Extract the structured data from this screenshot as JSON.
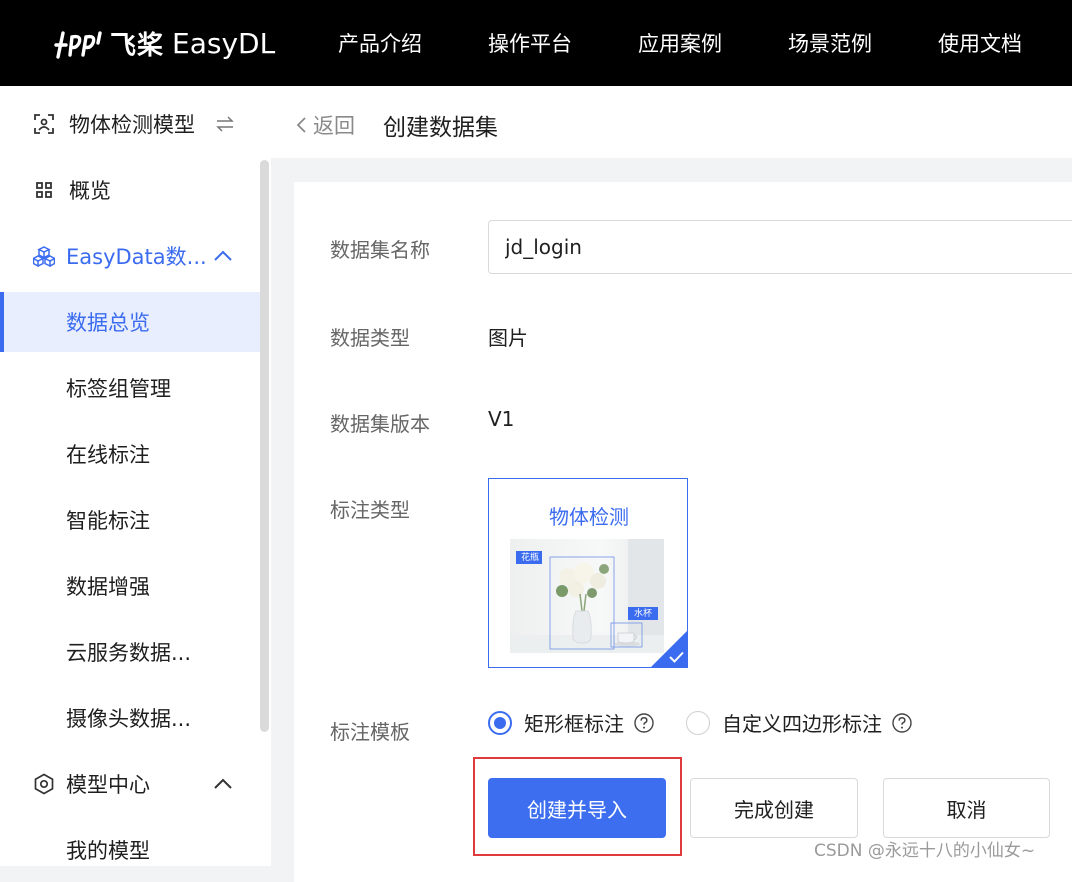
{
  "topbar": {
    "logo_cn": "飞桨",
    "logo_en": "EasyDL",
    "nav": [
      "产品介绍",
      "操作平台",
      "应用案例",
      "场景范例",
      "使用文档"
    ]
  },
  "sidebar": {
    "model_switch": "物体检测模型",
    "overview": "概览",
    "easydata": "EasyData数...",
    "items": [
      "数据总览",
      "标签组管理",
      "在线标注",
      "智能标注",
      "数据增强",
      "云服务数据...",
      "摄像头数据..."
    ],
    "model_center": "模型中心",
    "my_model": "我的模型"
  },
  "header": {
    "back": "返回",
    "title": "创建数据集"
  },
  "form": {
    "name_label": "数据集名称",
    "name_value": "jd_login",
    "type_label": "数据类型",
    "type_value": "图片",
    "version_label": "数据集版本",
    "version_value": "V1",
    "anno_type_label": "标注类型",
    "anno_type_card": "物体检测",
    "anno_tags": [
      "花瓶",
      "水杯"
    ],
    "template_label": "标注模板",
    "template_options": [
      "矩形框标注",
      "自定义四边形标注"
    ],
    "template_selected": "矩形框标注"
  },
  "buttons": {
    "create_import": "创建并导入",
    "finish": "完成创建",
    "cancel": "取消"
  },
  "watermark": "CSDN @永远十八的小仙女~",
  "colors": {
    "accent": "#3b6cf0",
    "topbar": "#000000",
    "highlight": "#e03a3a"
  }
}
